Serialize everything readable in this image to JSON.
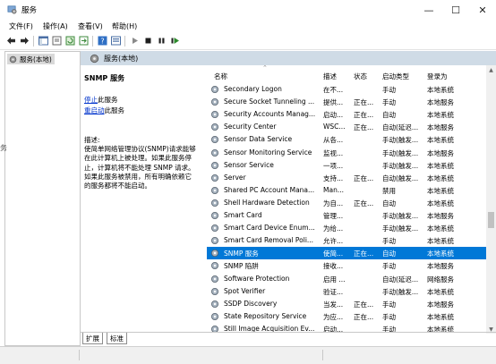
{
  "window": {
    "title": "服务",
    "minimize": "—",
    "maximize": "☐",
    "close": "✕"
  },
  "menu": [
    "文件(F)",
    "操作(A)",
    "查看(V)",
    "帮助(H)"
  ],
  "tree": {
    "root_label": "服务(本地)"
  },
  "content_header": "服务(本地)",
  "detail": {
    "service_name": "SNMP 服务",
    "stop_link": "停止",
    "stop_suffix": "此服务",
    "restart_link": "重启动",
    "restart_suffix": "此服务",
    "desc_lines": [
      "描述:",
      "使简单网络管理协议(SNMP)请求能够",
      "在此计算机上被处理。如果此服务停",
      "止，计算机将不能处理 SNMP 请求。",
      "如果此服务被禁用，所有明确依赖它",
      "的服务都将不能启动。"
    ]
  },
  "columns": [
    "名称",
    "描述",
    "状态",
    "启动类型",
    "登录为"
  ],
  "rows": [
    {
      "name": "Secondary Logon",
      "desc": "在不...",
      "status": "",
      "startup": "手动",
      "logon": "本地系统"
    },
    {
      "name": "Secure Socket Tunneling ...",
      "desc": "提供...",
      "status": "正在...",
      "startup": "手动",
      "logon": "本地服务"
    },
    {
      "name": "Security Accounts Manag...",
      "desc": "启动...",
      "status": "正在...",
      "startup": "自动",
      "logon": "本地系统"
    },
    {
      "name": "Security Center",
      "desc": "WSC...",
      "status": "正在...",
      "startup": "自动(延迟...",
      "logon": "本地服务"
    },
    {
      "name": "Sensor Data Service",
      "desc": "从各...",
      "status": "",
      "startup": "手动(触发...",
      "logon": "本地系统"
    },
    {
      "name": "Sensor Monitoring Service",
      "desc": "监视...",
      "status": "",
      "startup": "手动(触发...",
      "logon": "本地服务"
    },
    {
      "name": "Sensor Service",
      "desc": "一项...",
      "status": "",
      "startup": "手动(触发...",
      "logon": "本地系统"
    },
    {
      "name": "Server",
      "desc": "支持...",
      "status": "正在...",
      "startup": "自动(触发...",
      "logon": "本地系统"
    },
    {
      "name": "Shared PC Account Mana...",
      "desc": "Man...",
      "status": "",
      "startup": "禁用",
      "logon": "本地系统"
    },
    {
      "name": "Shell Hardware Detection",
      "desc": "为自...",
      "status": "正在...",
      "startup": "自动",
      "logon": "本地系统"
    },
    {
      "name": "Smart Card",
      "desc": "管理...",
      "status": "",
      "startup": "手动(触发...",
      "logon": "本地服务"
    },
    {
      "name": "Smart Card Device Enum...",
      "desc": "为给...",
      "status": "",
      "startup": "手动(触发...",
      "logon": "本地系统"
    },
    {
      "name": "Smart Card Removal Poli...",
      "desc": "允许...",
      "status": "",
      "startup": "手动",
      "logon": "本地系统"
    },
    {
      "name": "SNMP 服务",
      "desc": "使简...",
      "status": "正在...",
      "startup": "自动",
      "logon": "本地系统"
    },
    {
      "name": "SNMP 陷阱",
      "desc": "接收...",
      "status": "",
      "startup": "手动",
      "logon": "本地服务"
    },
    {
      "name": "Software Protection",
      "desc": "启用 ...",
      "status": "",
      "startup": "自动(延迟...",
      "logon": "网络服务"
    },
    {
      "name": "Spot Verifier",
      "desc": "验证...",
      "status": "",
      "startup": "手动(触发...",
      "logon": "本地系统"
    },
    {
      "name": "SSDP Discovery",
      "desc": "当发...",
      "status": "正在...",
      "startup": "手动",
      "logon": "本地服务"
    },
    {
      "name": "State Repository Service",
      "desc": "为应...",
      "status": "正在...",
      "startup": "手动",
      "logon": "本地系统"
    },
    {
      "name": "Still Image Acquisition Ev...",
      "desc": "启动...",
      "status": "",
      "startup": "手动",
      "logon": "本地系统"
    }
  ],
  "selected_row": 13,
  "tabs": [
    "扩展",
    "标准"
  ],
  "left_edge_char": "务",
  "colors": {
    "selection": "#0078d7",
    "header_bg": "#cfdbe6",
    "link": "#0033cc"
  }
}
